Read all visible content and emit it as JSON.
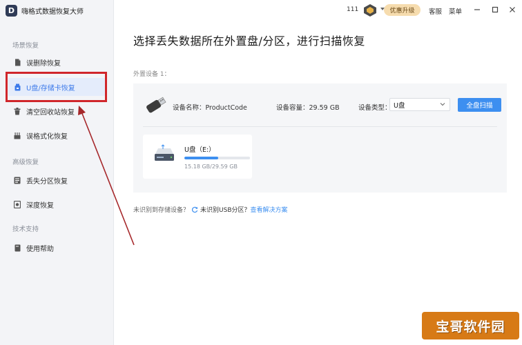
{
  "app": {
    "title": "嗨格式数据恢复大师",
    "logo_letter": "D"
  },
  "titlebar": {
    "count": "111",
    "upgrade_label": "优惠升级",
    "service_label": "客服",
    "menu_label": "菜单",
    "accent": "#f6dcae"
  },
  "sidebar": {
    "section_scene": "场景恢复",
    "section_advanced": "高级恢复",
    "section_support": "技术支持",
    "items": [
      {
        "label": "误删除恢复",
        "icon": "file-icon"
      },
      {
        "label": "U盘/存储卡恢复",
        "icon": "usb-card-icon"
      },
      {
        "label": "清空回收站恢复",
        "icon": "trash-icon"
      },
      {
        "label": "误格式化恢复",
        "icon": "format-icon"
      },
      {
        "label": "丢失分区恢复",
        "icon": "partition-icon"
      },
      {
        "label": "深度恢复",
        "icon": "deep-scan-icon"
      },
      {
        "label": "使用帮助",
        "icon": "help-book-icon"
      }
    ]
  },
  "main": {
    "heading": "选择丢失数据所在外置盘/分区，进行扫描恢复",
    "external_label": "外置设备 1：",
    "device": {
      "name_label": "设备名称：ProductCode",
      "capacity_label": "设备容量：29.59 GB",
      "type_label": "设备类型：",
      "type_value": "U盘",
      "scan_label": "全盘扫描"
    },
    "partition": {
      "name": "U盘（E:）",
      "size": "15.18 GB/29.59 GB",
      "used_fraction": 0.513
    },
    "help": {
      "question": "未识别到存储设备？",
      "usb_text": "未识别USB分区？",
      "link": "查看解决方案"
    }
  },
  "watermark": "宝哥软件园",
  "colors": {
    "primary": "#3d8ff0",
    "annotation": "#d0262b",
    "sidebar_bg": "#f3f4f7"
  }
}
